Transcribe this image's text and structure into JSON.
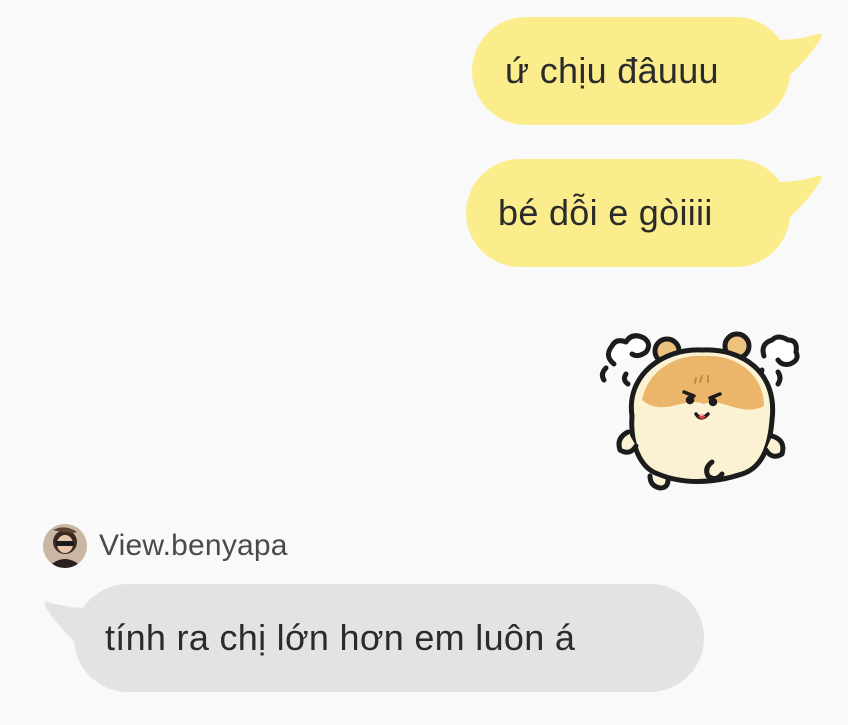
{
  "conversation": {
    "messages": [
      {
        "direction": "outgoing",
        "type": "text",
        "text": "ứ chịu đâuuu"
      },
      {
        "direction": "outgoing",
        "type": "text",
        "text": "bé dỗi e gòiiii"
      },
      {
        "direction": "outgoing",
        "type": "sticker",
        "sticker": "angry-hamster-sticker"
      },
      {
        "direction": "incoming",
        "type": "text",
        "sender": "View.benyapa",
        "text": "tính ra chị lớn hơn em luôn á"
      }
    ]
  },
  "colors": {
    "background": "#f9f9f9",
    "outgoing_bubble": "#fbec8c",
    "incoming_bubble": "#e3e3e3",
    "text": "#2b2b2b",
    "sender_name": "#4a4a4a"
  }
}
